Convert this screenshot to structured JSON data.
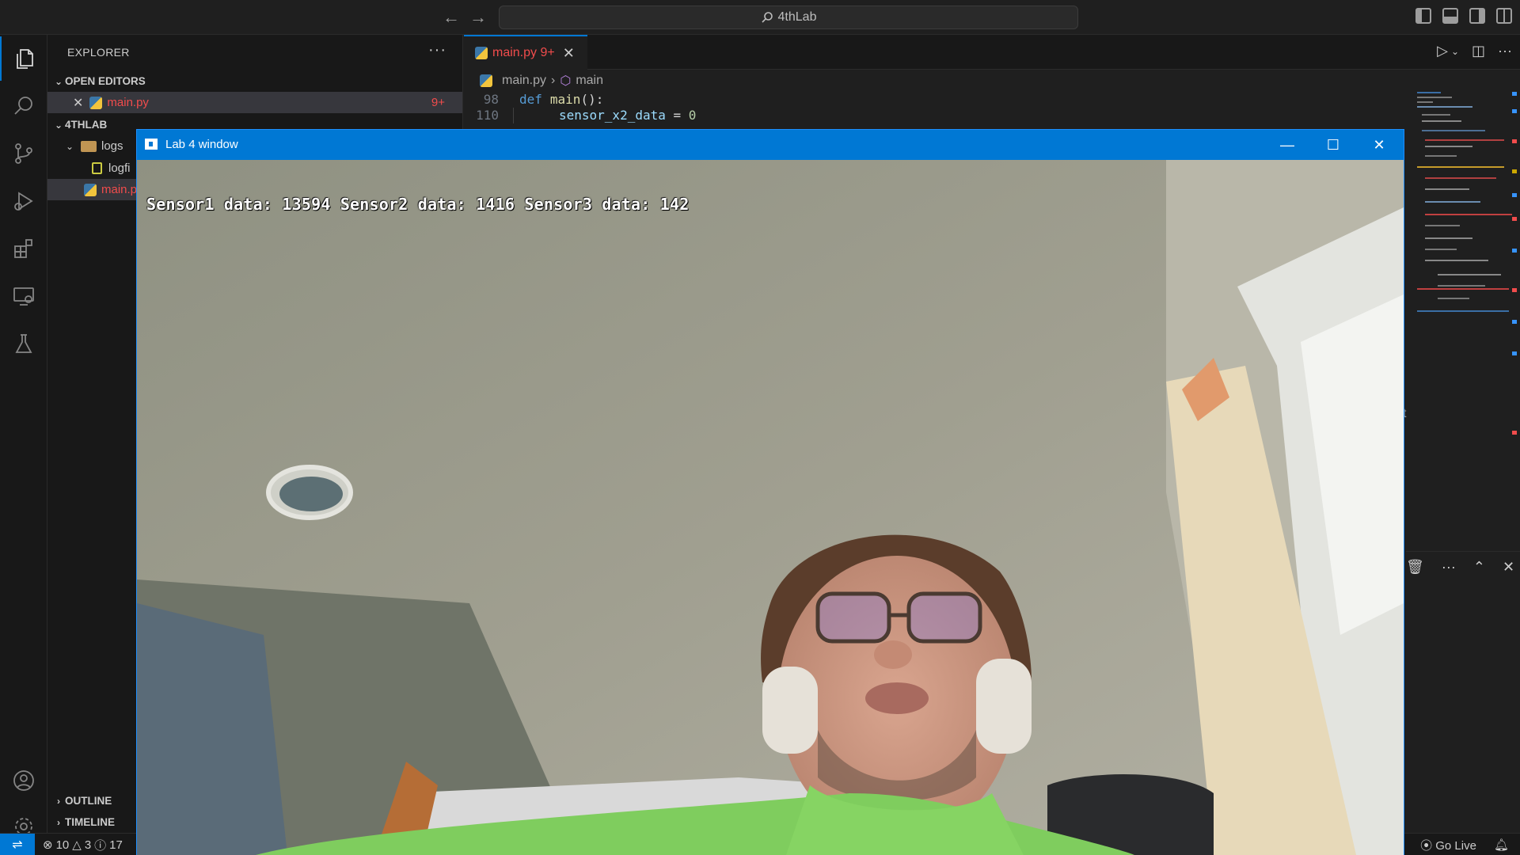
{
  "titlebar": {
    "search": "4thLab"
  },
  "explorer": {
    "title": "EXPLORER",
    "open_editors_label": "OPEN EDITORS",
    "open_editor_file": "main.py",
    "open_editor_badge": "9+",
    "project_label": "4THLAB",
    "folder": "logs",
    "log_file": "logfi",
    "main_file": "main.p",
    "outline_label": "OUTLINE",
    "timeline_label": "TIMELINE"
  },
  "editor": {
    "tab_label": "main.py 9+",
    "breadcrumb_file": "main.py",
    "breadcrumb_symbol": "main",
    "lines": [
      {
        "num": "98",
        "keyword": "def",
        "fn": "main",
        "rest": "():"
      },
      {
        "num": "110",
        "var": "sensor_x2_data",
        "op": " = ",
        "value": "0"
      }
    ]
  },
  "window": {
    "title": "Lab 4 window",
    "overlay": "Sensor1 data: 13594 Sensor2 data: 1416 Sensor3 data: 142"
  },
  "statusbar": {
    "errors": "10",
    "warnings": "3",
    "infos": "17",
    "go_live": "Go Live"
  },
  "side_fragment": "t"
}
